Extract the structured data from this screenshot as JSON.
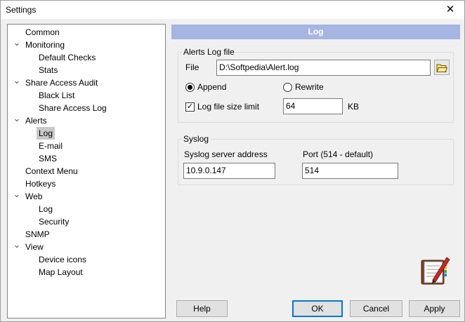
{
  "window": {
    "title": "Settings"
  },
  "tree": {
    "items": [
      {
        "label": "Common",
        "level": 0,
        "expanded": null
      },
      {
        "label": "Monitoring",
        "level": 0,
        "expanded": true
      },
      {
        "label": "Default Checks",
        "level": 1,
        "expanded": null
      },
      {
        "label": "Stats",
        "level": 1,
        "expanded": null
      },
      {
        "label": "Share Access Audit",
        "level": 0,
        "expanded": true
      },
      {
        "label": "Black List",
        "level": 1,
        "expanded": null
      },
      {
        "label": "Share Access Log",
        "level": 1,
        "expanded": null
      },
      {
        "label": "Alerts",
        "level": 0,
        "expanded": true
      },
      {
        "label": "Log",
        "level": 1,
        "expanded": null,
        "selected": true
      },
      {
        "label": "E-mail",
        "level": 1,
        "expanded": null
      },
      {
        "label": "SMS",
        "level": 1,
        "expanded": null
      },
      {
        "label": "Context Menu",
        "level": 0,
        "expanded": null
      },
      {
        "label": "Hotkeys",
        "level": 0,
        "expanded": null
      },
      {
        "label": "Web",
        "level": 0,
        "expanded": true
      },
      {
        "label": "Log",
        "level": 1,
        "expanded": null
      },
      {
        "label": "Security",
        "level": 1,
        "expanded": null
      },
      {
        "label": "SNMP",
        "level": 0,
        "expanded": null
      },
      {
        "label": "View",
        "level": 0,
        "expanded": true
      },
      {
        "label": "Device icons",
        "level": 1,
        "expanded": null
      },
      {
        "label": "Map Layout",
        "level": 1,
        "expanded": null
      }
    ]
  },
  "panel": {
    "header": "Log",
    "alerts_log": {
      "group_title": "Alerts Log file",
      "file_label": "File",
      "file_value": "D:\\Softpedia\\Alert.log",
      "browse_icon": "folder-open-icon",
      "append_label": "Append",
      "append_checked": true,
      "rewrite_label": "Rewrite",
      "rewrite_checked": false,
      "size_limit_label": "Log file size limit",
      "size_limit_checked": true,
      "size_value": "64",
      "size_unit": "KB"
    },
    "syslog": {
      "group_title": "Syslog",
      "server_label": "Syslog server address",
      "server_value": "10.9.0.147",
      "port_label": "Port (514 - default)",
      "port_value": "514"
    }
  },
  "buttons": {
    "help": "Help",
    "ok": "OK",
    "cancel": "Cancel",
    "apply": "Apply"
  },
  "colors": {
    "header_bg": "#a7b5e3",
    "selection_bg": "#c8c8c8",
    "default_button_border": "#0078d7"
  }
}
